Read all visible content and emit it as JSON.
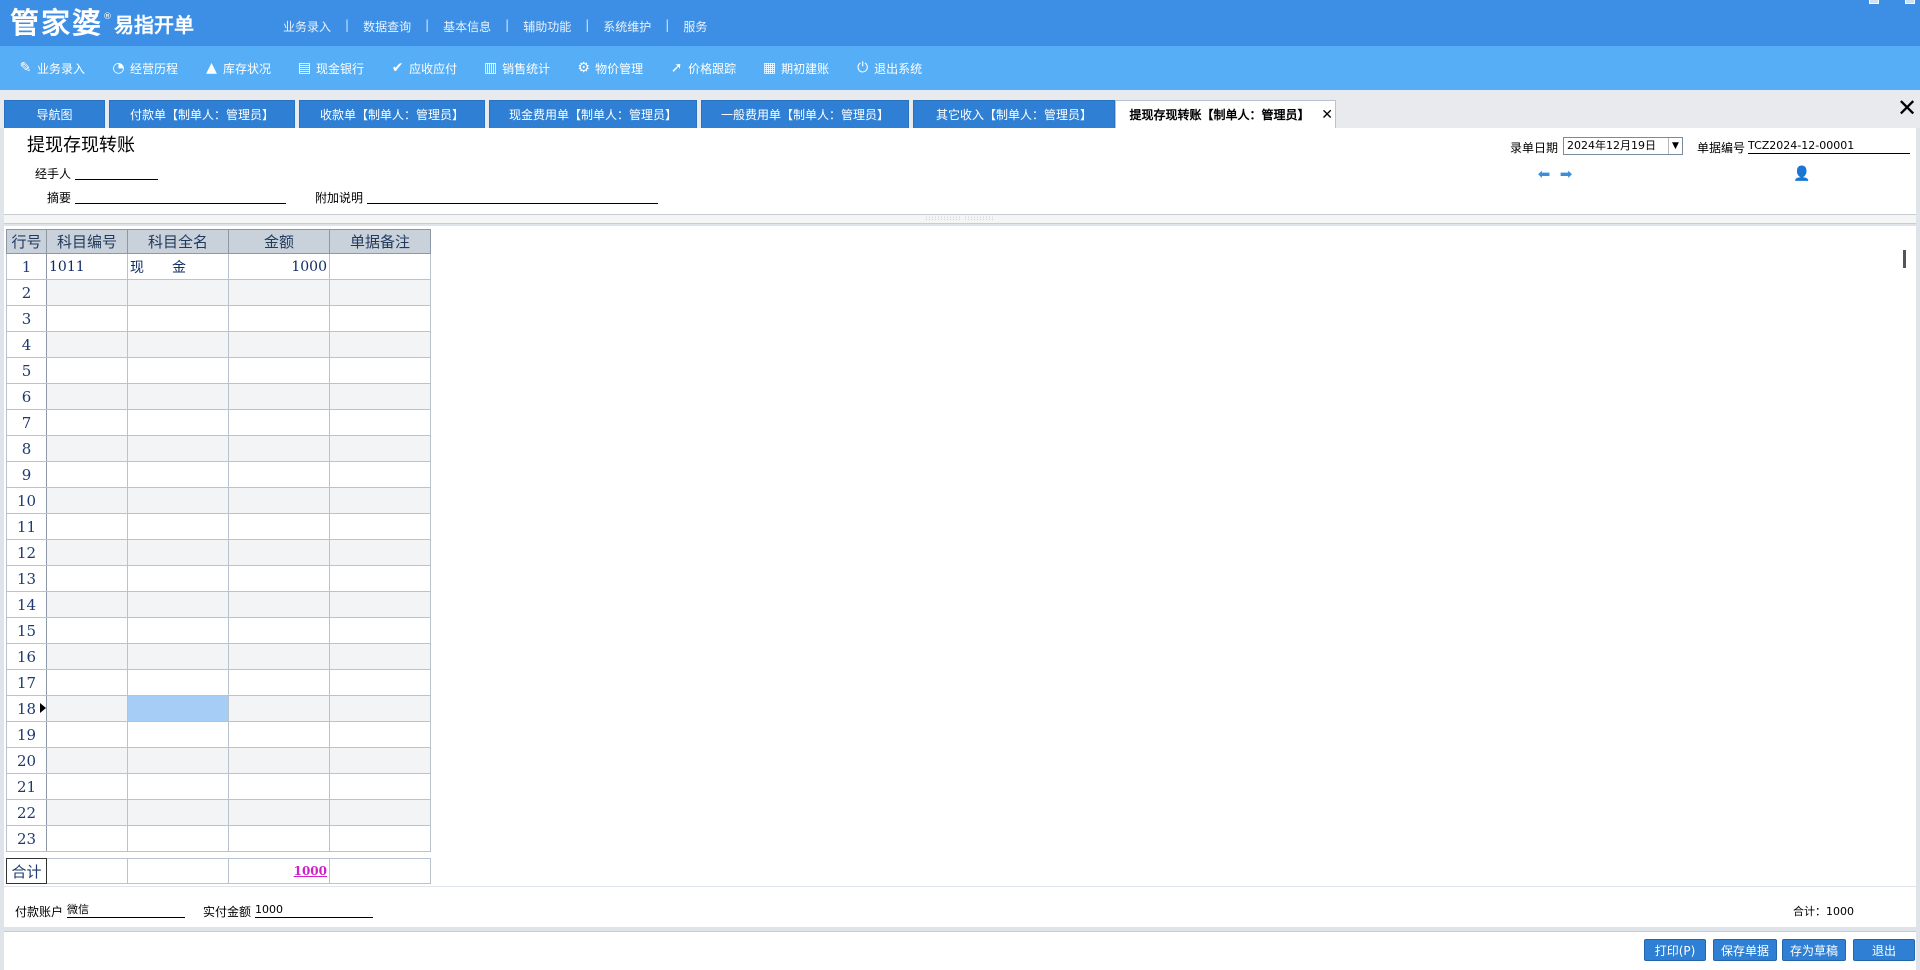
{
  "app": {
    "logo_main": "管家婆",
    "logo_reg": "®",
    "logo_sub": "易指开单"
  },
  "topmenu": [
    "业务录入",
    "数据查询",
    "基本信息",
    "辅助功能",
    "系统维护",
    "服务"
  ],
  "toolbar": [
    {
      "label": "业务录入",
      "icon": "pen-icon"
    },
    {
      "label": "经营历程",
      "icon": "pie-chart-icon"
    },
    {
      "label": "库存状况",
      "icon": "warehouse-icon"
    },
    {
      "label": "现金银行",
      "icon": "bank-book-icon"
    },
    {
      "label": "应收应付",
      "icon": "check-circle-icon"
    },
    {
      "label": "销售统计",
      "icon": "bar-chart-icon"
    },
    {
      "label": "物价管理",
      "icon": "gear-icon"
    },
    {
      "label": "价格跟踪",
      "icon": "arrow-up-right-icon"
    },
    {
      "label": "期初建账",
      "icon": "calculator-icon"
    },
    {
      "label": "退出系统",
      "icon": "power-icon"
    }
  ],
  "tabs": [
    {
      "label": "导航图",
      "active": false
    },
    {
      "label": "付款单【制单人：管理员】",
      "active": false
    },
    {
      "label": "收款单【制单人：管理员】",
      "active": false
    },
    {
      "label": "现金费用单【制单人：管理员】",
      "active": false
    },
    {
      "label": "一般费用单【制单人：管理员】",
      "active": false
    },
    {
      "label": "其它收入【制单人：管理员】",
      "active": false
    },
    {
      "label": "提现存现转账【制单人：管理员】",
      "active": true,
      "close": "✕"
    }
  ],
  "form": {
    "title": "提现存现转账",
    "handler_label": "经手人",
    "handler_value": "",
    "summary_label": "摘要",
    "summary_value": "",
    "note_label": "附加说明",
    "note_value": "",
    "date_label": "录单日期",
    "date_value": "2024年12月19日",
    "docno_label": "单据编号",
    "docno_value": "TCZ2024-12-00001"
  },
  "grid": {
    "headers": [
      "行号",
      "科目编号",
      "科目全名",
      "金额",
      "单据备注"
    ],
    "rows": [
      {
        "code": "1011",
        "name": "现　　金",
        "amount": "1000",
        "note": ""
      }
    ],
    "total_rows": 23,
    "selected_row": 18,
    "total_label": "合计",
    "total_amount": "1000"
  },
  "footer": {
    "account_label": "付款账户",
    "account_value": "微信",
    "paid_label": "实付金额",
    "paid_value": "1000",
    "sum_text": "合计：1000"
  },
  "buttons": {
    "print": "打印(P)",
    "save": "保存单据",
    "draft": "存为草稿",
    "exit": "退出"
  }
}
